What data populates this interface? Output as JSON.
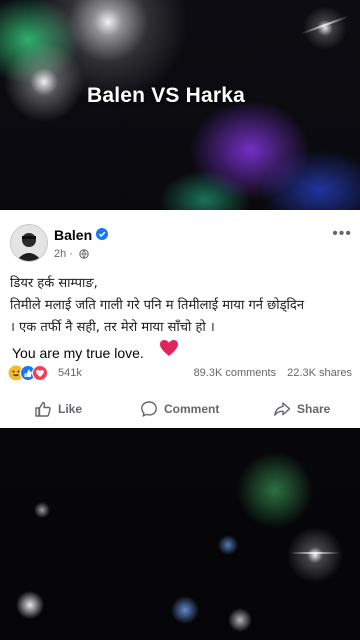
{
  "video": {
    "title": "Balen VS Harka"
  },
  "post": {
    "author": "Balen",
    "time": "2h",
    "more_icon": "more-dots-icon",
    "text_lines": [
      "डियर हर्क साम्पाङ,",
      "तिमीले मलाई जति गाली गरे पनि म तिमीलाई माया गर्न छोड्दिन",
      "। एक तर्फी नै सही, तर मेरो माया साँचो हो ।"
    ],
    "english_line": "You are my true love.",
    "reaction_count": "541k",
    "comments": "89.3K comments",
    "shares": "22.3K shares"
  },
  "actions": {
    "like": "Like",
    "comment": "Comment",
    "share": "Share"
  },
  "colors": {
    "verified": "#1877f2",
    "heart": "#e0245e",
    "card_bg": "#ffffff"
  }
}
